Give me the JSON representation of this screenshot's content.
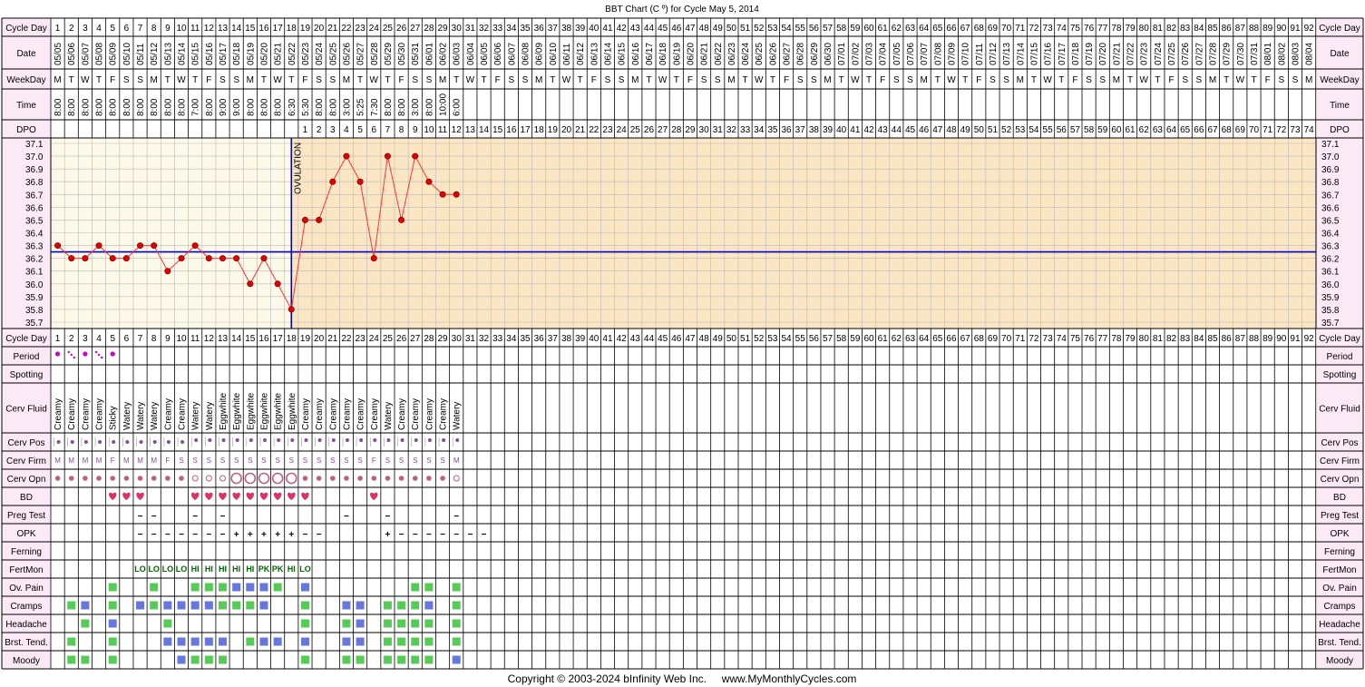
{
  "title": "BBT Chart (C º) for Cycle May 5, 2014",
  "copyright": "Copyright © 2003-2024 bInfinity Web Inc.     www.MyMonthlyCycles.com",
  "ovulation_label": "OVULATION",
  "row_labels": {
    "cycle_day": "Cycle Day",
    "date": "Date",
    "weekday": "WeekDay",
    "time": "Time",
    "dpo": "DPO",
    "period": "Period",
    "spotting": "Spotting",
    "cerv_fluid": "Cerv Fluid",
    "cerv_pos": "Cerv Pos",
    "cerv_firm": "Cerv Firm",
    "cerv_opn": "Cerv Opn",
    "bd": "BD",
    "preg_test": "Preg Test",
    "opk": "OPK",
    "ferning": "Ferning",
    "fertmon": "FertMon",
    "ov_pain": "Ov. Pain",
    "cramps": "Cramps",
    "headache": "Headache",
    "brst_tend": "Brst. Tend.",
    "moody": "Moody"
  },
  "dates": [
    "05/05",
    "05/06",
    "05/07",
    "05/08",
    "05/09",
    "05/10",
    "05/11",
    "05/12",
    "05/13",
    "05/14",
    "05/15",
    "05/16",
    "05/17",
    "05/18",
    "05/19",
    "05/20",
    "05/21",
    "05/22",
    "05/23",
    "05/24",
    "05/25",
    "05/26",
    "05/27",
    "05/28",
    "05/29",
    "05/30",
    "05/31",
    "06/01",
    "06/02",
    "06/03",
    "06/04",
    "06/05",
    "06/06",
    "06/07",
    "06/08",
    "06/09",
    "06/10",
    "06/11",
    "06/12",
    "06/13",
    "06/14",
    "06/15",
    "06/16",
    "06/17",
    "06/18",
    "06/19",
    "06/20",
    "06/21",
    "06/22",
    "06/23",
    "06/24",
    "06/25",
    "06/26",
    "06/27",
    "06/28",
    "06/29",
    "06/30",
    "07/01",
    "07/02",
    "07/03",
    "07/04",
    "07/05",
    "07/06",
    "07/07",
    "07/08",
    "07/09",
    "07/10",
    "07/11",
    "07/12",
    "07/13",
    "07/14",
    "07/15",
    "07/16",
    "07/17",
    "07/18",
    "07/19",
    "07/20",
    "07/21",
    "07/22",
    "07/23",
    "07/24",
    "07/25",
    "07/26",
    "07/27",
    "07/28",
    "07/29",
    "07/30",
    "07/31",
    "08/01",
    "08/02",
    "08/03",
    "08/04"
  ],
  "times": [
    "8:00",
    "8:00",
    "8:00",
    "8:00",
    "8:00",
    "8:00",
    "8:00",
    "8:00",
    "8:00",
    "8:00",
    "7:00",
    "8:00",
    "9:00",
    "9:00",
    "8:00",
    "8:00",
    "8:00",
    "6:30",
    "5:30",
    "8:00",
    "8:00",
    "3:00",
    "5:25",
    "7:30",
    "8:00",
    "8:00",
    "3:00",
    "8:00",
    "10:00",
    "6:00"
  ],
  "cerv_fluid": [
    "Creamy",
    "Creamy",
    "Creamy",
    "Creamy",
    "Sticky",
    "Watery",
    "Watery",
    "Watery",
    "Creamy",
    "Creamy",
    "Watery",
    "Watery",
    "Eggwhite",
    "Eggwhite",
    "Eggwhite",
    "Eggwhite",
    "Eggwhite",
    "Eggwhite",
    "Creamy",
    "Creamy",
    "Creamy",
    "Creamy",
    "Creamy",
    "Creamy",
    "Watery",
    "Creamy",
    "Creamy",
    "Creamy",
    "Creamy",
    "Watery"
  ],
  "cerv_firm": [
    "M",
    "M",
    "M",
    "M",
    "F",
    "M",
    "M",
    "M",
    "F",
    "S",
    "S",
    "S",
    "S",
    "S",
    "S",
    "S",
    "S",
    "S",
    "S",
    "S",
    "S",
    "S",
    "S",
    "F",
    "S",
    "S",
    "S",
    "S",
    "S",
    "M"
  ],
  "cerv_opn": [
    "d",
    "d",
    "d",
    "d",
    "d",
    "d",
    "d",
    "d",
    "d",
    "d",
    "o",
    "o",
    "o",
    "O",
    "O",
    "O",
    "O",
    "O",
    "d",
    "d",
    "d",
    "d",
    "d",
    "d",
    "d",
    "d",
    "d",
    "d",
    "d",
    "o"
  ],
  "fertmon": [
    "",
    "",
    "",
    "",
    "",
    "",
    "LO",
    "LO",
    "LO",
    "LO",
    "HI",
    "HI",
    "HI",
    "HI",
    "HI",
    "PK",
    "PK",
    "HI",
    "LO",
    "",
    "",
    "",
    "",
    "",
    "",
    "",
    "",
    "",
    "",
    ""
  ],
  "preg_test": [
    "",
    "",
    "",
    "",
    "",
    "",
    "−",
    "−",
    "",
    "",
    "−",
    "",
    "−",
    "",
    "",
    "",
    "",
    "",
    "",
    "",
    "",
    "−",
    "",
    "",
    "−",
    "",
    "",
    "",
    "",
    "−"
  ],
  "opk": [
    "",
    "",
    "",
    "",
    "",
    "",
    "−",
    "−",
    "−",
    "−",
    "−",
    "−",
    "−",
    "+",
    "+",
    "+",
    "+",
    "+",
    "−",
    "−",
    "",
    "",
    "",
    "",
    "+",
    "−",
    "−",
    "−",
    "−",
    "−",
    "−",
    "−"
  ],
  "bd": [
    5,
    6,
    7,
    11,
    12,
    13,
    14,
    15,
    16,
    17,
    18,
    19,
    24
  ],
  "period": [
    1,
    2,
    3,
    4,
    5
  ],
  "symptoms": {
    "ov_pain": [
      5,
      8,
      11,
      12,
      13,
      14,
      15,
      16,
      17,
      19,
      27,
      28,
      30
    ],
    "cramps": [
      2,
      3,
      5,
      7,
      8,
      9,
      10,
      11,
      12,
      13,
      14,
      15,
      16,
      19,
      22,
      23,
      25,
      26,
      27,
      28,
      30
    ],
    "headache": [
      3,
      5,
      9,
      19,
      22,
      23,
      25,
      26,
      27,
      28,
      30
    ],
    "brst_tend": [
      2,
      5,
      9,
      10,
      11,
      12,
      13,
      15,
      16,
      17,
      19,
      22,
      23,
      25,
      26,
      27,
      28,
      30
    ],
    "moody": [
      2,
      3,
      5,
      10,
      11,
      12,
      13,
      19,
      22,
      23,
      25,
      26,
      27,
      28,
      30
    ]
  },
  "colors": {
    "chart_bg_pre": "#fdf9e9",
    "chart_bg_post": "#fbe6c4",
    "line": "#ff3333",
    "point": "#e00000",
    "coverline": "#0000cc",
    "ovulation_line": "#0000cc",
    "heart": "#e0306a",
    "green": "#55cc55",
    "blue": "#6677dd",
    "purple": "#8a4a9a",
    "label_bg": "#fce9f6"
  },
  "chart_data": {
    "type": "line",
    "title": "BBT Chart (C º) for Cycle May 5, 2014",
    "x_label": "Cycle Day",
    "x": [
      1,
      2,
      3,
      4,
      5,
      6,
      7,
      8,
      9,
      10,
      11,
      12,
      13,
      14,
      15,
      16,
      17,
      18,
      19,
      20,
      21,
      22,
      23,
      24,
      25,
      26,
      27,
      28,
      29,
      30
    ],
    "y": [
      36.3,
      36.2,
      36.2,
      36.3,
      36.2,
      36.2,
      36.3,
      36.3,
      36.1,
      36.2,
      36.3,
      36.2,
      36.2,
      36.2,
      36.0,
      36.2,
      36.0,
      35.8,
      36.5,
      36.5,
      36.8,
      37.0,
      36.8,
      36.2,
      37.0,
      36.5,
      37.0,
      36.8,
      36.7,
      36.7
    ],
    "ylim": [
      35.7,
      37.1
    ],
    "y_ticks": [
      "37.1",
      "37.0",
      "36.9",
      "36.8",
      "36.7",
      "36.6",
      "36.5",
      "36.4",
      "36.3",
      "36.2",
      "36.1",
      "36.0",
      "35.9",
      "35.8",
      "35.7"
    ],
    "x_range": [
      1,
      92
    ],
    "coverline": 36.25,
    "ovulation_day": 18,
    "dpo": [
      1,
      2,
      3,
      4,
      5,
      6,
      7,
      8,
      9,
      10,
      11,
      12,
      13,
      14,
      15,
      16,
      17,
      18,
      19,
      20,
      21,
      22,
      23,
      24,
      25,
      26,
      27,
      28,
      29,
      30,
      31,
      32,
      33,
      34,
      35,
      36,
      37,
      38,
      39,
      40,
      41,
      42,
      43,
      44,
      45,
      46,
      47,
      48,
      49,
      50,
      51,
      52,
      53,
      54,
      55,
      56,
      57,
      58,
      59,
      60,
      61,
      62,
      63,
      64,
      65,
      66,
      67,
      68,
      69,
      70,
      71,
      72,
      73,
      74
    ],
    "grid": true
  }
}
